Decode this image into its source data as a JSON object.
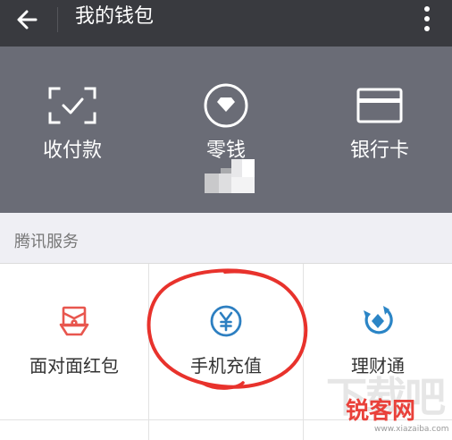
{
  "header": {
    "title": "我的钱包",
    "back_icon": "arrow-left-icon",
    "more_icon": "more-vertical-icon"
  },
  "wallet": {
    "items": [
      {
        "label": "收付款",
        "icon": "scan-check-icon"
      },
      {
        "label": "零钱",
        "icon": "diamond-coin-icon"
      },
      {
        "label": "银行卡",
        "icon": "bank-card-icon"
      }
    ]
  },
  "services": {
    "section_title": "腾讯服务",
    "items": [
      {
        "label": "面对面红包",
        "icon": "red-packet-icon",
        "color": "#e8564e"
      },
      {
        "label": "手机充值",
        "icon": "yuan-coin-icon",
        "color": "#2d7fc1"
      },
      {
        "label": "理财通",
        "icon": "licaitong-icon",
        "color": "#2b85c6"
      }
    ]
  },
  "annotation": {
    "color": "#e8322c"
  },
  "watermark": {
    "big_text": "下载吧",
    "brand": "锐客网",
    "url": "www.xiazaiba.com"
  },
  "colors": {
    "topbar": "#393a3f",
    "panel": "#6a6c76",
    "background": "#efeff4"
  }
}
